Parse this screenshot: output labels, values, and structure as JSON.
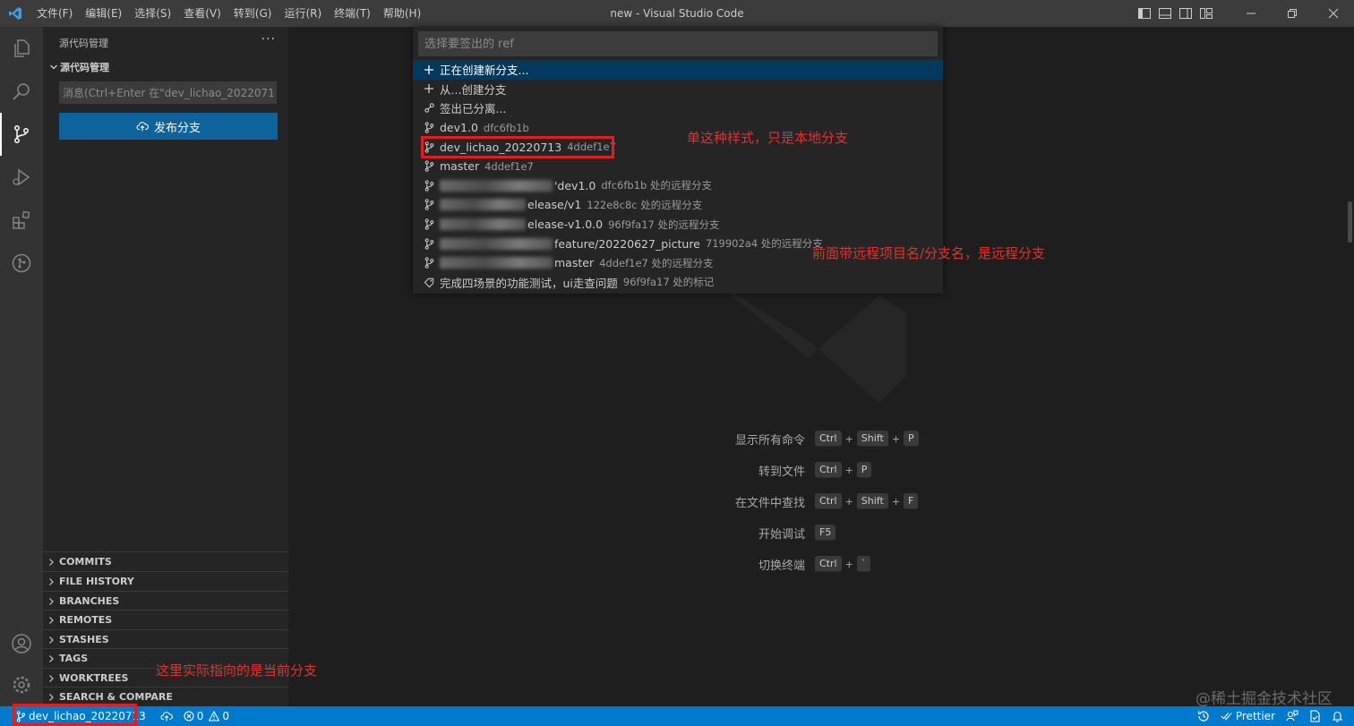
{
  "window": {
    "title": "new - Visual Studio Code",
    "menu": [
      "文件(F)",
      "编辑(E)",
      "选择(S)",
      "查看(V)",
      "转到(G)",
      "运行(R)",
      "终端(T)",
      "帮助(H)"
    ]
  },
  "activity_bar": [
    "files-icon",
    "search-icon",
    "source-control-icon",
    "run-debug-icon",
    "extensions-icon",
    "git-graph-icon",
    "account-icon",
    "settings-gear-icon"
  ],
  "sidebar": {
    "title": "源代码管理",
    "more": "···",
    "section_title": "源代码管理",
    "message_placeholder": "消息(Ctrl+Enter 在\"dev_lichao_2022071...",
    "publish_label": "发布分支",
    "panels": [
      "COMMITS",
      "FILE HISTORY",
      "BRANCHES",
      "REMOTES",
      "STASHES",
      "TAGS",
      "WORKTREES",
      "SEARCH & COMPARE"
    ]
  },
  "quick_pick": {
    "placeholder": "选择要签出的 ref",
    "items": [
      {
        "label": "正在创建新分支...",
        "desc": "",
        "icon": "plus"
      },
      {
        "label": "从...创建分支",
        "desc": "",
        "icon": "plus"
      },
      {
        "label": "签出已分离...",
        "desc": "",
        "icon": "detach"
      },
      {
        "label": "dev1.0",
        "desc": "dfc6fb1b",
        "icon": "branch"
      },
      {
        "label": "dev_lichao_20220713",
        "desc": "4ddef1e7",
        "icon": "branch"
      },
      {
        "label": "master",
        "desc": "4ddef1e7",
        "icon": "branch"
      },
      {
        "label": "'dev1.0",
        "desc": "dfc6fb1b 处的远程分支",
        "icon": "branch"
      },
      {
        "label": "elease/v1",
        "desc": "122e8c8c 处的远程分支",
        "icon": "branch"
      },
      {
        "label": "elease-v1.0.0",
        "desc": "96f9fa17 处的远程分支",
        "icon": "branch"
      },
      {
        "label": "feature/20220627_picture",
        "desc": "719902a4 处的远程分支",
        "icon": "branch"
      },
      {
        "label": "master",
        "desc": "4ddef1e7 处的远程分支",
        "icon": "branch"
      },
      {
        "label": "完成四场景的功能测试，ui走查问题",
        "desc": "96f9fa17 处的标记",
        "icon": "tag"
      }
    ]
  },
  "shortcuts": [
    {
      "label": "显示所有命令",
      "keys": [
        "Ctrl",
        "+",
        "Shift",
        "+",
        "P"
      ]
    },
    {
      "label": "转到文件",
      "keys": [
        "Ctrl",
        "+",
        "P"
      ]
    },
    {
      "label": "在文件中查找",
      "keys": [
        "Ctrl",
        "+",
        "Shift",
        "+",
        "F"
      ]
    },
    {
      "label": "开始调试",
      "keys": [
        "F5"
      ]
    },
    {
      "label": "切换终端",
      "keys": [
        "Ctrl",
        "+",
        "`"
      ]
    }
  ],
  "annotations": {
    "local_branch": "单这种样式，只是本地分支",
    "remote_branch": "前面带远程项目名/分支名，是远程分支",
    "current_branch": "这里实际指向的是当前分支"
  },
  "status_bar": {
    "branch": "dev_lichao_20220713",
    "errors": "0",
    "warnings": "0",
    "prettier": "Prettier"
  },
  "watermark": "@稀土掘金技术社区"
}
